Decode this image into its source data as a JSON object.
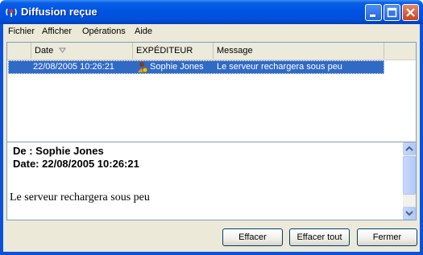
{
  "window": {
    "title": "Diffusion reçue"
  },
  "menubar": {
    "items": [
      "Fichier",
      "Afficher",
      "Opérations",
      "Aide"
    ]
  },
  "list": {
    "columns": [
      "Date",
      "EXPÉDITEUR",
      "Message"
    ],
    "rows": [
      {
        "date": "22/08/2005 10:26:21",
        "sender": "Sophie Jones",
        "message": "Le serveur rechargera sous peu"
      }
    ]
  },
  "detail": {
    "from_line": "De : Sophie Jones",
    "date_line": "Date: 22/08/2005 10:26:21",
    "body": "Le serveur rechargera sous peu"
  },
  "buttons": {
    "clear": "Effacer",
    "clear_all": "Effacer tout",
    "close": "Fermer"
  },
  "colors": {
    "titlebar": "#0054e3",
    "selection": "#316ac5",
    "face": "#ece9d8"
  }
}
